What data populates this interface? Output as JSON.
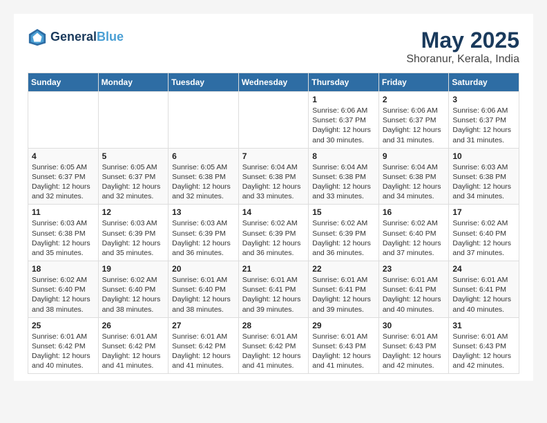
{
  "header": {
    "logo_line1": "General",
    "logo_line2": "Blue",
    "title": "May 2025",
    "subtitle": "Shoranur, Kerala, India"
  },
  "calendar": {
    "days_of_week": [
      "Sunday",
      "Monday",
      "Tuesday",
      "Wednesday",
      "Thursday",
      "Friday",
      "Saturday"
    ],
    "weeks": [
      [
        {
          "day": "",
          "info": ""
        },
        {
          "day": "",
          "info": ""
        },
        {
          "day": "",
          "info": ""
        },
        {
          "day": "",
          "info": ""
        },
        {
          "day": "1",
          "info": "Sunrise: 6:06 AM\nSunset: 6:37 PM\nDaylight: 12 hours\nand 30 minutes."
        },
        {
          "day": "2",
          "info": "Sunrise: 6:06 AM\nSunset: 6:37 PM\nDaylight: 12 hours\nand 31 minutes."
        },
        {
          "day": "3",
          "info": "Sunrise: 6:06 AM\nSunset: 6:37 PM\nDaylight: 12 hours\nand 31 minutes."
        }
      ],
      [
        {
          "day": "4",
          "info": "Sunrise: 6:05 AM\nSunset: 6:37 PM\nDaylight: 12 hours\nand 32 minutes."
        },
        {
          "day": "5",
          "info": "Sunrise: 6:05 AM\nSunset: 6:37 PM\nDaylight: 12 hours\nand 32 minutes."
        },
        {
          "day": "6",
          "info": "Sunrise: 6:05 AM\nSunset: 6:38 PM\nDaylight: 12 hours\nand 32 minutes."
        },
        {
          "day": "7",
          "info": "Sunrise: 6:04 AM\nSunset: 6:38 PM\nDaylight: 12 hours\nand 33 minutes."
        },
        {
          "day": "8",
          "info": "Sunrise: 6:04 AM\nSunset: 6:38 PM\nDaylight: 12 hours\nand 33 minutes."
        },
        {
          "day": "9",
          "info": "Sunrise: 6:04 AM\nSunset: 6:38 PM\nDaylight: 12 hours\nand 34 minutes."
        },
        {
          "day": "10",
          "info": "Sunrise: 6:03 AM\nSunset: 6:38 PM\nDaylight: 12 hours\nand 34 minutes."
        }
      ],
      [
        {
          "day": "11",
          "info": "Sunrise: 6:03 AM\nSunset: 6:38 PM\nDaylight: 12 hours\nand 35 minutes."
        },
        {
          "day": "12",
          "info": "Sunrise: 6:03 AM\nSunset: 6:39 PM\nDaylight: 12 hours\nand 35 minutes."
        },
        {
          "day": "13",
          "info": "Sunrise: 6:03 AM\nSunset: 6:39 PM\nDaylight: 12 hours\nand 36 minutes."
        },
        {
          "day": "14",
          "info": "Sunrise: 6:02 AM\nSunset: 6:39 PM\nDaylight: 12 hours\nand 36 minutes."
        },
        {
          "day": "15",
          "info": "Sunrise: 6:02 AM\nSunset: 6:39 PM\nDaylight: 12 hours\nand 36 minutes."
        },
        {
          "day": "16",
          "info": "Sunrise: 6:02 AM\nSunset: 6:40 PM\nDaylight: 12 hours\nand 37 minutes."
        },
        {
          "day": "17",
          "info": "Sunrise: 6:02 AM\nSunset: 6:40 PM\nDaylight: 12 hours\nand 37 minutes."
        }
      ],
      [
        {
          "day": "18",
          "info": "Sunrise: 6:02 AM\nSunset: 6:40 PM\nDaylight: 12 hours\nand 38 minutes."
        },
        {
          "day": "19",
          "info": "Sunrise: 6:02 AM\nSunset: 6:40 PM\nDaylight: 12 hours\nand 38 minutes."
        },
        {
          "day": "20",
          "info": "Sunrise: 6:01 AM\nSunset: 6:40 PM\nDaylight: 12 hours\nand 38 minutes."
        },
        {
          "day": "21",
          "info": "Sunrise: 6:01 AM\nSunset: 6:41 PM\nDaylight: 12 hours\nand 39 minutes."
        },
        {
          "day": "22",
          "info": "Sunrise: 6:01 AM\nSunset: 6:41 PM\nDaylight: 12 hours\nand 39 minutes."
        },
        {
          "day": "23",
          "info": "Sunrise: 6:01 AM\nSunset: 6:41 PM\nDaylight: 12 hours\nand 40 minutes."
        },
        {
          "day": "24",
          "info": "Sunrise: 6:01 AM\nSunset: 6:41 PM\nDaylight: 12 hours\nand 40 minutes."
        }
      ],
      [
        {
          "day": "25",
          "info": "Sunrise: 6:01 AM\nSunset: 6:42 PM\nDaylight: 12 hours\nand 40 minutes."
        },
        {
          "day": "26",
          "info": "Sunrise: 6:01 AM\nSunset: 6:42 PM\nDaylight: 12 hours\nand 41 minutes."
        },
        {
          "day": "27",
          "info": "Sunrise: 6:01 AM\nSunset: 6:42 PM\nDaylight: 12 hours\nand 41 minutes."
        },
        {
          "day": "28",
          "info": "Sunrise: 6:01 AM\nSunset: 6:42 PM\nDaylight: 12 hours\nand 41 minutes."
        },
        {
          "day": "29",
          "info": "Sunrise: 6:01 AM\nSunset: 6:43 PM\nDaylight: 12 hours\nand 41 minutes."
        },
        {
          "day": "30",
          "info": "Sunrise: 6:01 AM\nSunset: 6:43 PM\nDaylight: 12 hours\nand 42 minutes."
        },
        {
          "day": "31",
          "info": "Sunrise: 6:01 AM\nSunset: 6:43 PM\nDaylight: 12 hours\nand 42 minutes."
        }
      ]
    ]
  }
}
